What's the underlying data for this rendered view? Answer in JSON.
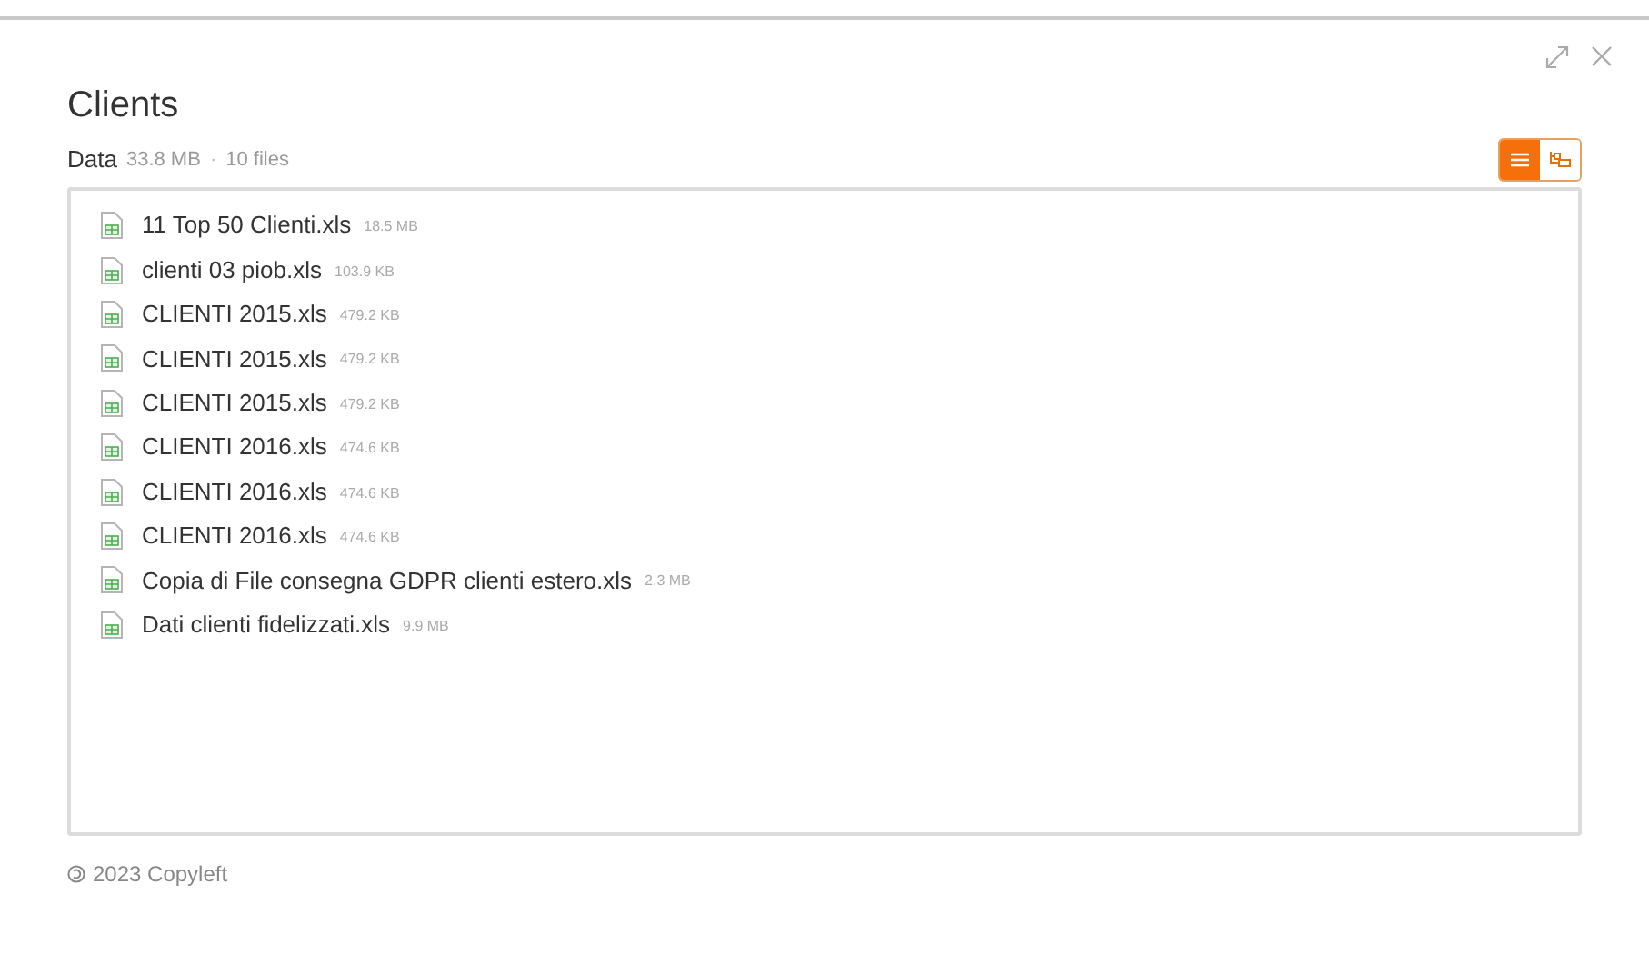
{
  "dialog": {
    "title": "Clients"
  },
  "summary": {
    "label": "Data",
    "size": "33.8 MB",
    "separator": "·",
    "count": "10 files"
  },
  "view_toggle": [
    {
      "kind": "list",
      "selected": true
    },
    {
      "kind": "tree",
      "selected": false
    }
  ],
  "files": [
    {
      "name": "11 Top 50 Clienti.xls",
      "size": "18.5 MB"
    },
    {
      "name": "clienti 03 piob.xls",
      "size": "103.9 KB"
    },
    {
      "name": "CLIENTI 2015.xls",
      "size": "479.2 KB"
    },
    {
      "name": "CLIENTI 2015.xls",
      "size": "479.2 KB"
    },
    {
      "name": "CLIENTI 2015.xls",
      "size": "479.2 KB"
    },
    {
      "name": "CLIENTI 2016.xls",
      "size": "474.6 KB"
    },
    {
      "name": "CLIENTI 2016.xls",
      "size": "474.6 KB"
    },
    {
      "name": "CLIENTI 2016.xls",
      "size": "474.6 KB"
    },
    {
      "name": "Copia di File consegna GDPR clienti estero.xls",
      "size": "2.3 MB"
    },
    {
      "name": "Dati clienti fidelizzati.xls",
      "size": "9.9 MB"
    }
  ],
  "footer": {
    "text": "2023 Copyleft"
  }
}
